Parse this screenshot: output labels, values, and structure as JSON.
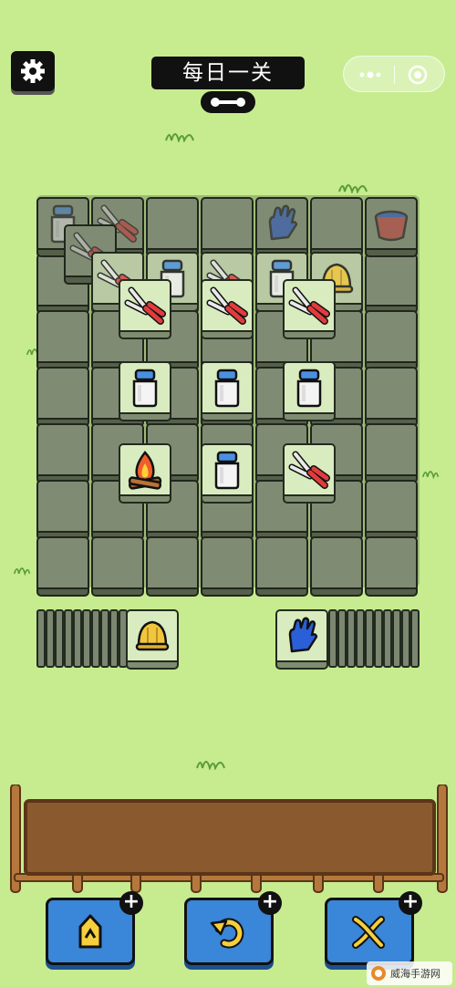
{
  "header": {
    "level_title": "每日一关",
    "settings_icon": "gear-icon",
    "link_icon": "link-icon",
    "capsule": {
      "more_icon": "more-dots-icon",
      "close_icon": "target-close-icon"
    }
  },
  "board": {
    "tiles": [
      {
        "icon": "milk-can-icon",
        "state": "dim"
      },
      {
        "icon": "scissors-icon",
        "state": "dim"
      },
      {
        "icon": "glove-icon",
        "state": "dim"
      },
      {
        "icon": "tub-icon",
        "state": "dim"
      },
      {
        "icon": "scissors-icon",
        "state": "dim"
      },
      {
        "icon": "scissors-icon",
        "state": "mid"
      },
      {
        "icon": "milk-can-icon",
        "state": "mid"
      },
      {
        "icon": "scissors-icon",
        "state": "mid"
      },
      {
        "icon": "milk-can-icon",
        "state": "mid"
      },
      {
        "icon": "bell-icon",
        "state": "mid"
      },
      {
        "icon": "scissors-icon",
        "state": "top"
      },
      {
        "icon": "scissors-icon",
        "state": "top"
      },
      {
        "icon": "scissors-icon",
        "state": "top"
      },
      {
        "icon": "milk-can-icon",
        "state": "top"
      },
      {
        "icon": "milk-can-icon",
        "state": "top"
      },
      {
        "icon": "milk-can-icon",
        "state": "top"
      },
      {
        "icon": "campfire-icon",
        "state": "top"
      },
      {
        "icon": "milk-can-icon",
        "state": "top"
      },
      {
        "icon": "scissors-icon",
        "state": "top"
      }
    ]
  },
  "left_stack": {
    "top_icon": "bell-icon"
  },
  "right_stack": {
    "top_icon": "glove-icon"
  },
  "tray": {
    "slots": 0
  },
  "tools": [
    {
      "name": "move-out",
      "icon": "move-out-icon",
      "badge": "+"
    },
    {
      "name": "undo",
      "icon": "undo-icon",
      "badge": "+"
    },
    {
      "name": "shuffle",
      "icon": "shuffle-icon",
      "badge": "+"
    }
  ],
  "watermark": {
    "text": "威海手游网"
  },
  "colors": {
    "background": "#c6ec8f",
    "tool_button": "#3a86d8",
    "tile_face": "#d9ecc0"
  }
}
